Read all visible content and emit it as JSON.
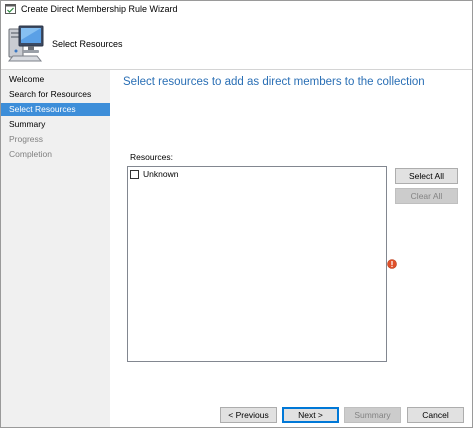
{
  "window": {
    "title": "Create Direct Membership Rule Wizard"
  },
  "header": {
    "title": "Select Resources"
  },
  "sidebar": {
    "items": [
      {
        "label": "Welcome",
        "state": "normal"
      },
      {
        "label": "Search for Resources",
        "state": "normal"
      },
      {
        "label": "Select Resources",
        "state": "active"
      },
      {
        "label": "Summary",
        "state": "normal"
      },
      {
        "label": "Progress",
        "state": "disabled"
      },
      {
        "label": "Completion",
        "state": "disabled"
      }
    ]
  },
  "main": {
    "heading": "Select resources to add as direct members to the collection",
    "resources_label": "Resources:",
    "resources": [
      {
        "label": "Unknown",
        "checked": false
      }
    ],
    "select_all_label": "Select All",
    "clear_all_label": "Clear All"
  },
  "footer": {
    "previous_label": "< Previous",
    "next_label": "Next >",
    "summary_label": "Summary",
    "cancel_label": "Cancel"
  },
  "colors": {
    "accent": "#3d8ed9",
    "heading": "#2a6fb5",
    "sidebar_bg": "#f0f0f0",
    "error": "#e0502a"
  },
  "icons": {
    "app": "wizard-window-icon",
    "header": "computer-icon",
    "validation": "error-icon"
  }
}
